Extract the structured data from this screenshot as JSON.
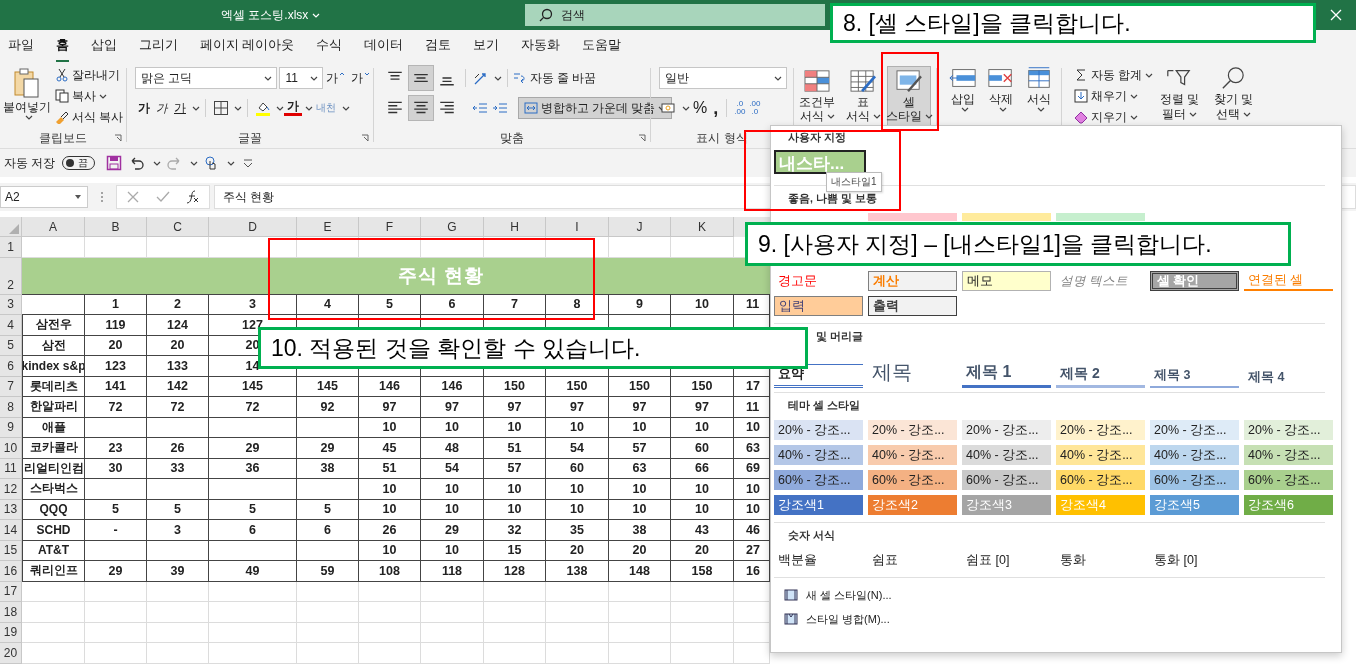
{
  "window": {
    "title": "엑셀 포스팅.xlsx",
    "search_placeholder": "검색"
  },
  "menu_tabs": [
    {
      "label": "파일",
      "selected": false
    },
    {
      "label": "홈",
      "selected": true
    },
    {
      "label": "삽입",
      "selected": false
    },
    {
      "label": "그리기",
      "selected": false
    },
    {
      "label": "페이지 레이아웃",
      "selected": false
    },
    {
      "label": "수식",
      "selected": false
    },
    {
      "label": "데이터",
      "selected": false
    },
    {
      "label": "검토",
      "selected": false
    },
    {
      "label": "보기",
      "selected": false
    },
    {
      "label": "자동화",
      "selected": false
    },
    {
      "label": "도움말",
      "selected": false
    }
  ],
  "ribbon": {
    "clipboard": {
      "label": "클립보드",
      "paste": "붙여넣기",
      "cut": "잘라내기",
      "copy": "복사",
      "format_painter": "서식 복사"
    },
    "font": {
      "label": "글꼴",
      "name": "맑은 고딕",
      "size": "11",
      "grow": "가",
      "shrink": "가",
      "bold": "가",
      "italic": "가",
      "underline": "가",
      "font_color": "가",
      "phonetic": "내천"
    },
    "alignment": {
      "label": "맞춤",
      "vertical": [
        {
          "kind": "top",
          "selected": false
        },
        {
          "kind": "middle",
          "selected": true
        },
        {
          "kind": "bottom",
          "selected": false
        }
      ],
      "horizontal": [
        {
          "kind": "left",
          "selected": false
        },
        {
          "kind": "center",
          "selected": true
        },
        {
          "kind": "right",
          "selected": false
        }
      ],
      "wrap": "자동 줄 바꿈",
      "merge": "병합하고 가운데 맞춤",
      "merge_on": true
    },
    "number": {
      "label": "표시 형식",
      "format": "일반",
      "percent": "%",
      "comma": ",",
      "increase_decimal": [
        ".0",
        ".00"
      ],
      "decrease_decimal": [
        ".00",
        ".0"
      ]
    },
    "styles": [
      {
        "kind": "conditional",
        "lines": [
          "조건부",
          "서식"
        ],
        "selected": false
      },
      {
        "kind": "table",
        "lines": [
          "표",
          "서식"
        ],
        "selected": false
      },
      {
        "kind": "cell",
        "lines": [
          "셀",
          "스타일"
        ],
        "selected": true
      }
    ],
    "cells": [
      {
        "kind": "insert",
        "label": "삽입"
      },
      {
        "kind": "delete",
        "label": "삭제"
      },
      {
        "kind": "format",
        "label": "서식"
      }
    ],
    "editing": {
      "autosum": "자동 합계",
      "fill": "채우기",
      "clear": "지우기",
      "sort": [
        "정렬 및",
        "필터"
      ],
      "find": [
        "찾기 및",
        "선택"
      ]
    }
  },
  "quick_access": {
    "autosave_label": "자동 저장",
    "autosave_state": "끔",
    "autosave_on": false
  },
  "formula_bar": {
    "name_box": "A2",
    "formula": "주식 현황"
  },
  "sheet": {
    "columns": [
      "A",
      "B",
      "C",
      "D",
      "E",
      "F",
      "G",
      "H",
      "I",
      "J",
      "K"
    ],
    "row_numbers": [
      "1",
      "2",
      "3",
      "4",
      "5",
      "6",
      "7",
      "8",
      "9",
      "10",
      "11",
      "12",
      "13",
      "14",
      "15",
      "16",
      "17",
      "18",
      "19",
      "20"
    ],
    "title": "주식 현황",
    "header_row": [
      "1",
      "2",
      "3",
      "4",
      "5",
      "6",
      "7",
      "8",
      "9",
      "10",
      "11"
    ],
    "rows": [
      {
        "name": "삼전우",
        "cells": {
          "B": "119",
          "C": "124",
          "D": "127"
        }
      },
      {
        "name": "삼전",
        "cells": {
          "B": "20",
          "C": "20",
          "D": "20"
        }
      },
      {
        "name": "kindex s&p",
        "cells": {
          "B": "123",
          "C": "133",
          "D": "14"
        }
      },
      {
        "name": "롯데리츠",
        "cells": {
          "B": "141",
          "C": "142",
          "D": "145",
          "E": "145",
          "F": "146",
          "G": "146",
          "H": "150",
          "I": "150",
          "J": "150",
          "K": "150",
          "L": "17"
        }
      },
      {
        "name": "한알파리",
        "cells": {
          "B": "72",
          "C": "72",
          "D": "72",
          "E": "92",
          "F": "97",
          "G": "97",
          "H": "97",
          "I": "97",
          "J": "97",
          "K": "97",
          "L": "11"
        }
      },
      {
        "name": "애플",
        "cells": {
          "F": "10",
          "G": "10",
          "H": "10",
          "I": "10",
          "J": "10",
          "K": "10",
          "L": "10"
        }
      },
      {
        "name": "코카콜라",
        "cells": {
          "B": "23",
          "C": "26",
          "D": "29",
          "E": "29",
          "F": "45",
          "G": "48",
          "H": "51",
          "I": "54",
          "J": "57",
          "K": "60",
          "L": "63"
        }
      },
      {
        "name": "리얼티인컴",
        "cells": {
          "B": "30",
          "C": "33",
          "D": "36",
          "E": "38",
          "F": "51",
          "G": "54",
          "H": "57",
          "I": "60",
          "J": "63",
          "K": "66",
          "L": "69"
        }
      },
      {
        "name": "스타벅스",
        "cells": {
          "F": "10",
          "G": "10",
          "H": "10",
          "I": "10",
          "J": "10",
          "K": "10",
          "L": "10"
        }
      },
      {
        "name": "QQQ",
        "cells": {
          "B": "5",
          "C": "5",
          "D": "5",
          "E": "5",
          "F": "10",
          "G": "10",
          "H": "10",
          "I": "10",
          "J": "10",
          "K": "10",
          "L": "10"
        }
      },
      {
        "name": "SCHD",
        "cells": {
          "B": "-",
          "C": "3",
          "D": "6",
          "E": "6",
          "F": "26",
          "G": "29",
          "H": "32",
          "I": "35",
          "J": "38",
          "K": "43",
          "L": "46"
        }
      },
      {
        "name": "AT&T",
        "cells": {
          "F": "10",
          "G": "10",
          "H": "15",
          "I": "20",
          "J": "20",
          "K": "20",
          "L": "27"
        }
      },
      {
        "name": "쿼리인프",
        "cells": {
          "B": "29",
          "C": "39",
          "D": "49",
          "E": "59",
          "F": "108",
          "G": "118",
          "H": "128",
          "I": "138",
          "J": "148",
          "K": "158",
          "L": "16"
        }
      }
    ]
  },
  "cell_styles_menu": {
    "custom": {
      "header": "사용자 지정",
      "items": [
        {
          "label": "내스타...",
          "selected": true,
          "tooltip": "내스타일1"
        }
      ]
    },
    "good_bad": {
      "header": "좋음, 나쁨 및 보통",
      "swatches": [
        {
          "color": "#ffffff"
        },
        {
          "color": "#ffc7ce"
        },
        {
          "color": "#ffeb9c"
        },
        {
          "color": "#c6efce"
        }
      ]
    },
    "data_model": {
      "items": [
        {
          "label": "경고문",
          "kind": "warning"
        },
        {
          "label": "계산",
          "kind": "calculation"
        },
        {
          "label": "메모",
          "kind": "note"
        },
        {
          "label": "설명 텍스트",
          "kind": "explanatory"
        },
        {
          "label": "셀 확인",
          "kind": "check"
        },
        {
          "label": "연결된 셀",
          "kind": "linked"
        },
        {
          "label": "입력",
          "kind": "input"
        },
        {
          "label": "출력",
          "kind": "output"
        }
      ]
    },
    "headings": {
      "header": "및 머리글",
      "items": [
        {
          "label": "요약",
          "kind": "total"
        },
        {
          "label": "제목",
          "kind": "title"
        },
        {
          "label": "제목 1",
          "kind": "h1"
        },
        {
          "label": "제목 2",
          "kind": "h2"
        },
        {
          "label": "제목 3",
          "kind": "h3"
        },
        {
          "label": "제목 4",
          "kind": "h4"
        }
      ]
    },
    "theme": {
      "header": "테마 셀 스타일",
      "rows": [
        {
          "kind": "tint",
          "items": [
            {
              "label": "20% - 강조...",
              "color": "#dae3f3"
            },
            {
              "label": "20% - 강조...",
              "color": "#fbe5d6"
            },
            {
              "label": "20% - 강조...",
              "color": "#ededed"
            },
            {
              "label": "20% - 강조...",
              "color": "#fff2cc"
            },
            {
              "label": "20% - 강조...",
              "color": "#deebf7"
            },
            {
              "label": "20% - 강조...",
              "color": "#e2efda"
            }
          ]
        },
        {
          "kind": "tint",
          "items": [
            {
              "label": "40% - 강조...",
              "color": "#b4c7e7"
            },
            {
              "label": "40% - 강조...",
              "color": "#f8cbad"
            },
            {
              "label": "40% - 강조...",
              "color": "#dbdbdb"
            },
            {
              "label": "40% - 강조...",
              "color": "#ffe699"
            },
            {
              "label": "40% - 강조...",
              "color": "#bdd7ee"
            },
            {
              "label": "40% - 강조...",
              "color": "#c6e0b4"
            }
          ]
        },
        {
          "kind": "tint",
          "items": [
            {
              "label": "60% - 강조...",
              "color": "#8faadc"
            },
            {
              "label": "60% - 강조...",
              "color": "#f4b183"
            },
            {
              "label": "60% - 강조...",
              "color": "#c9c9c9"
            },
            {
              "label": "60% - 강조...",
              "color": "#ffd966"
            },
            {
              "label": "60% - 강조...",
              "color": "#9dc3e6"
            },
            {
              "label": "60% - 강조...",
              "color": "#a9d08e"
            }
          ]
        },
        {
          "kind": "solid",
          "items": [
            {
              "label": "강조색1",
              "color": "#4472c4"
            },
            {
              "label": "강조색2",
              "color": "#ed7d31"
            },
            {
              "label": "강조색3",
              "color": "#a5a5a5"
            },
            {
              "label": "강조색4",
              "color": "#ffc000"
            },
            {
              "label": "강조색5",
              "color": "#5b9bd5"
            },
            {
              "label": "강조색6",
              "color": "#70ad47"
            }
          ]
        }
      ]
    },
    "number": {
      "header": "숫자 서식",
      "items": [
        "백분율",
        "쉼표",
        "쉼표 [0]",
        "통화",
        "통화 [0]"
      ]
    },
    "actions": [
      {
        "label": "새 셀 스타일(N)...",
        "kind": "new"
      },
      {
        "label": "스타일 병합(M)...",
        "kind": "merge"
      }
    ]
  },
  "callouts": [
    {
      "text": "8. [셀 스타일]을 클릭합니다."
    },
    {
      "text": "9. [사용자 지정] – [내스타일1]을 클릭합니다."
    },
    {
      "text": "10. 적용된 것을 확인할 수 있습니다."
    }
  ]
}
